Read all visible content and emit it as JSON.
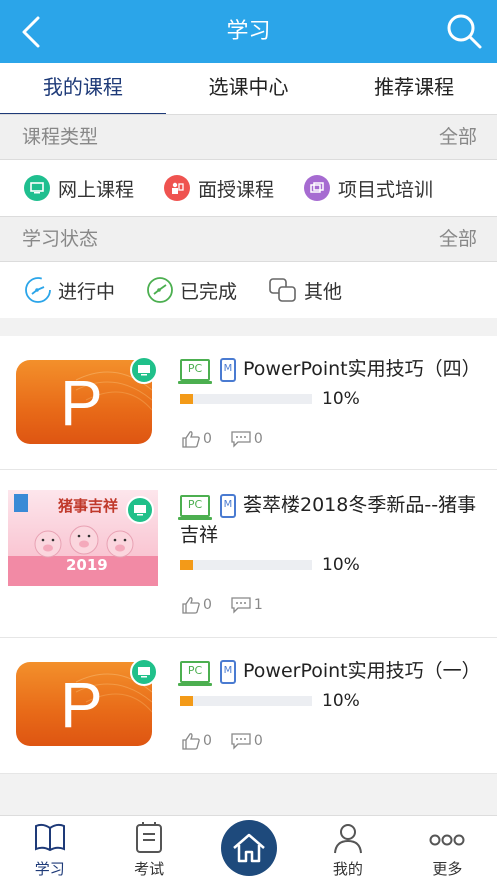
{
  "header": {
    "title": "学习"
  },
  "tabs": [
    {
      "label": "我的课程",
      "active": true
    },
    {
      "label": "选课中心",
      "active": false
    },
    {
      "label": "推荐课程",
      "active": false
    }
  ],
  "course_type": {
    "label": "课程类型",
    "all_label": "全部",
    "options": [
      {
        "label": "网上课程",
        "icon": "monitor-icon",
        "color": "#1fbf8f"
      },
      {
        "label": "面授课程",
        "icon": "classroom-icon",
        "color": "#ef5350"
      },
      {
        "label": "项目式培训",
        "icon": "project-icon",
        "color": "#a66bd1"
      }
    ]
  },
  "study_status": {
    "label": "学习状态",
    "all_label": "全部",
    "options": [
      {
        "label": "进行中",
        "icon": "in-progress-icon",
        "color": "#2ba5e9"
      },
      {
        "label": "已完成",
        "icon": "completed-icon",
        "color": "#4caf50"
      },
      {
        "label": "其他",
        "icon": "other-icon",
        "color": "#666666"
      }
    ]
  },
  "courses": [
    {
      "title": "PowerPoint实用技巧（四）",
      "progress_label": "10%",
      "progress": 0.1,
      "likes": "0",
      "comments": "0",
      "thumb": "ppt",
      "tag_pc": "PC",
      "tag_mobile": "M"
    },
    {
      "title": "荟萃楼2018冬季新品--猪事吉祥",
      "progress_label": "10%",
      "progress": 0.1,
      "likes": "0",
      "comments": "1",
      "thumb": "pig",
      "thumb_title": "猪事吉祥",
      "thumb_year": "2019",
      "tag_pc": "PC",
      "tag_mobile": "M"
    },
    {
      "title": "PowerPoint实用技巧（一）",
      "progress_label": "10%",
      "progress": 0.1,
      "likes": "0",
      "comments": "0",
      "thumb": "ppt",
      "tag_pc": "PC",
      "tag_mobile": "M"
    }
  ],
  "ppt_letter": "P",
  "tabbar": [
    {
      "label": "学习",
      "icon": "book-icon",
      "active": true
    },
    {
      "label": "考试",
      "icon": "exam-icon",
      "active": false
    },
    {
      "label": "",
      "icon": "home-icon",
      "active": false
    },
    {
      "label": "我的",
      "icon": "user-icon",
      "active": false
    },
    {
      "label": "更多",
      "icon": "more-icon",
      "active": false
    }
  ],
  "colors": {
    "header": "#2ba5e9",
    "accent": "#1e3a78",
    "progress": "#f39a18",
    "home_button": "#1e4a7c"
  }
}
